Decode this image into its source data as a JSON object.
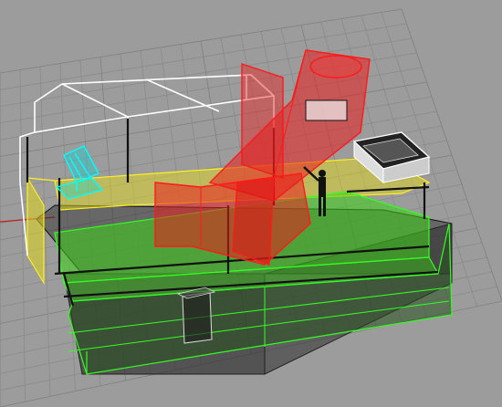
{
  "viewport": {
    "name": "perspective-viewport",
    "background": "#9c9c9c",
    "grid_color": "#8a8a8a",
    "grid_major_color": "#7f7f7f"
  },
  "colors": {
    "wire_white": "#ffffff",
    "wire_black": "#111111",
    "selected_red": "#ff1a1a",
    "selected_red_fill": "rgba(235,30,30,0.55)",
    "layer_yellow": "#ffee22",
    "layer_yellow_fill": "rgba(225,215,30,0.55)",
    "layer_green": "#33ff22",
    "layer_green_fill": "rgba(60,210,20,0.55)",
    "object_cyan": "#00ffff",
    "dark_fill": "rgba(40,40,40,0.55)",
    "axis_red": "#c02020"
  }
}
